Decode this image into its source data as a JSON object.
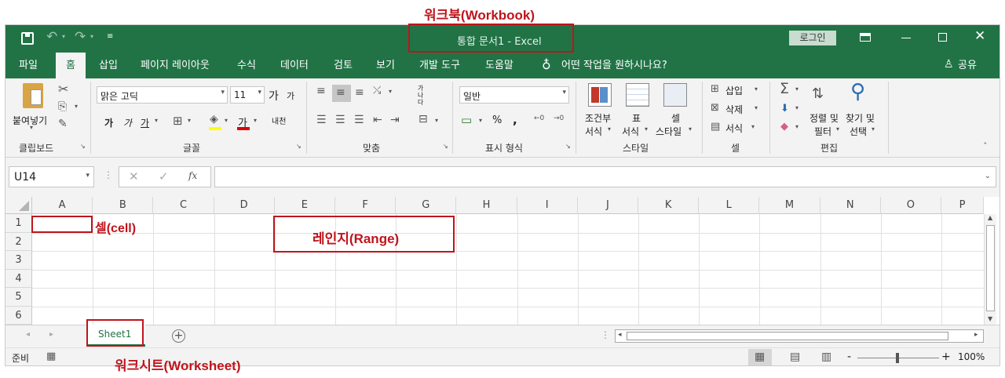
{
  "annotations": {
    "workbook": "워크북(Workbook)",
    "cell": "셀(cell)",
    "range": "레인지(Range)",
    "worksheet": "워크시트(Worksheet)"
  },
  "titlebar": {
    "title": "통합 문서1  -  Excel",
    "login": "로그인"
  },
  "tabs": [
    "파일",
    "홈",
    "삽입",
    "페이지 레이아웃",
    "수식",
    "데이터",
    "검토",
    "보기",
    "개발 도구",
    "도움말"
  ],
  "tell_me": "어떤 작업을 원하시나요?",
  "share": "공유",
  "ribbon": {
    "clipboard": {
      "label": "클립보드",
      "paste": "붙여넣기"
    },
    "font": {
      "label": "글꼴",
      "name": "맑은 고딕",
      "size": "11",
      "bold": "가",
      "italic": "가",
      "underline": "가",
      "color_letter": "가",
      "grow": "가",
      "shrink": "가",
      "phonetic": "내천"
    },
    "alignment": {
      "label": "맞춤",
      "wrap": "가나다"
    },
    "number": {
      "label": "표시 형식",
      "format": "일반",
      "percent": "%",
      "comma": ","
    },
    "styles": {
      "label": "스타일",
      "conditional1": "조건부",
      "conditional2": "서식",
      "table1": "표",
      "table2": "서식",
      "cell1": "셀",
      "cell2": "스타일"
    },
    "cells": {
      "label": "셀",
      "insert": "삽입",
      "delete": "삭제",
      "format": "서식"
    },
    "editing": {
      "label": "편집",
      "sort1": "정렬 및",
      "sort2": "필터",
      "find1": "찾기 및",
      "find2": "선택"
    }
  },
  "formula_bar": {
    "name_box": "U14",
    "fx": "fx",
    "value": ""
  },
  "columns": [
    "A",
    "B",
    "C",
    "D",
    "E",
    "F",
    "G",
    "H",
    "I",
    "J",
    "K",
    "L",
    "M",
    "N",
    "O",
    "P"
  ],
  "rows": [
    "1",
    "2",
    "3",
    "4",
    "5",
    "6"
  ],
  "sheets": [
    "Sheet1"
  ],
  "status": {
    "ready": "준비",
    "zoom": "100%",
    "minus": "-",
    "plus": "+"
  },
  "colors": {
    "excel_green": "#217346",
    "annotation_red": "#c0141c"
  }
}
